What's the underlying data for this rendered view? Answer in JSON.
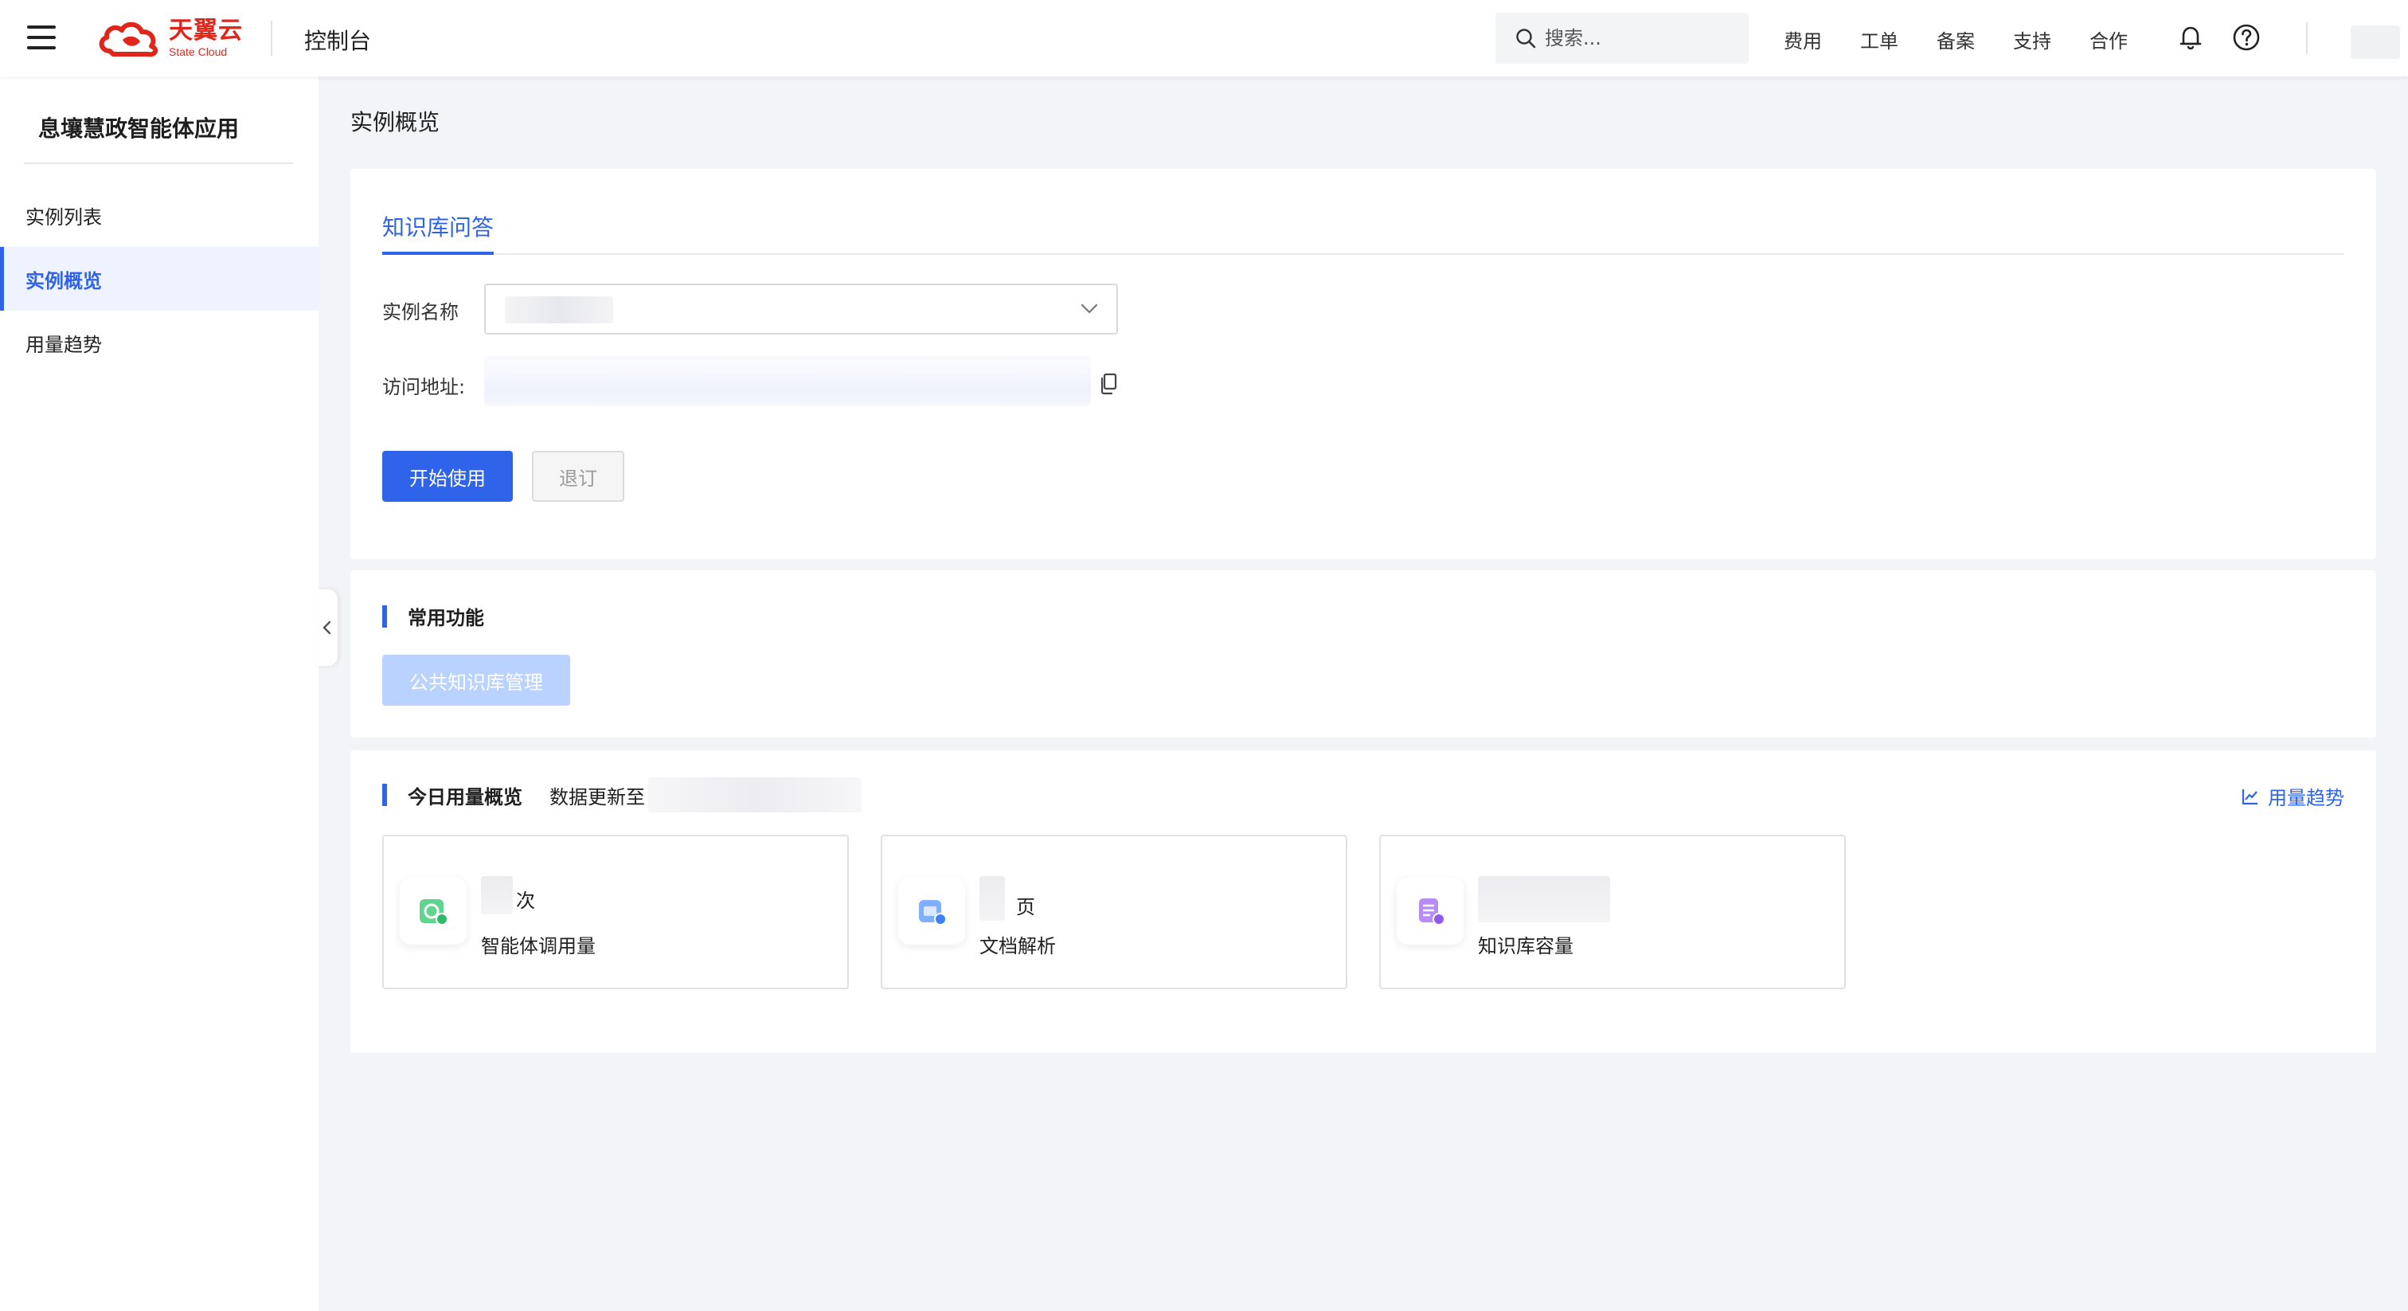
{
  "header": {
    "brand_cn": "天翼云",
    "brand_en": "State Cloud",
    "console_title": "控制台",
    "search_placeholder": "搜索...",
    "nav": [
      "费用",
      "工单",
      "备案",
      "支持",
      "合作"
    ]
  },
  "sidebar": {
    "title": "息壤慧政智能体应用",
    "items": [
      {
        "label": "实例列表",
        "active": false
      },
      {
        "label": "实例概览",
        "active": true
      },
      {
        "label": "用量趋势",
        "active": false
      }
    ]
  },
  "main": {
    "page_title": "实例概览",
    "tab": "知识库问答",
    "instance_name_label": "实例名称",
    "access_url_label": "访问地址:",
    "start_button": "开始使用",
    "unsubscribe_button": "退订",
    "common_features": {
      "title": "常用功能",
      "public_kb_button": "公共知识库管理"
    },
    "usage": {
      "title": "今日用量概览",
      "update_label": "数据更新至",
      "trend_link": "用量趋势",
      "stats": [
        {
          "unit": "次",
          "label": "智能体调用量",
          "icon": "agent-call-icon"
        },
        {
          "unit": "页",
          "label": "文档解析",
          "icon": "document-parse-icon"
        },
        {
          "unit": "",
          "label": "知识库容量",
          "icon": "knowledge-capacity-icon"
        }
      ]
    }
  },
  "colors": {
    "primary": "#2f63ea",
    "brand_red": "#e0251b",
    "disabled_light_blue": "#b9d2ff"
  }
}
